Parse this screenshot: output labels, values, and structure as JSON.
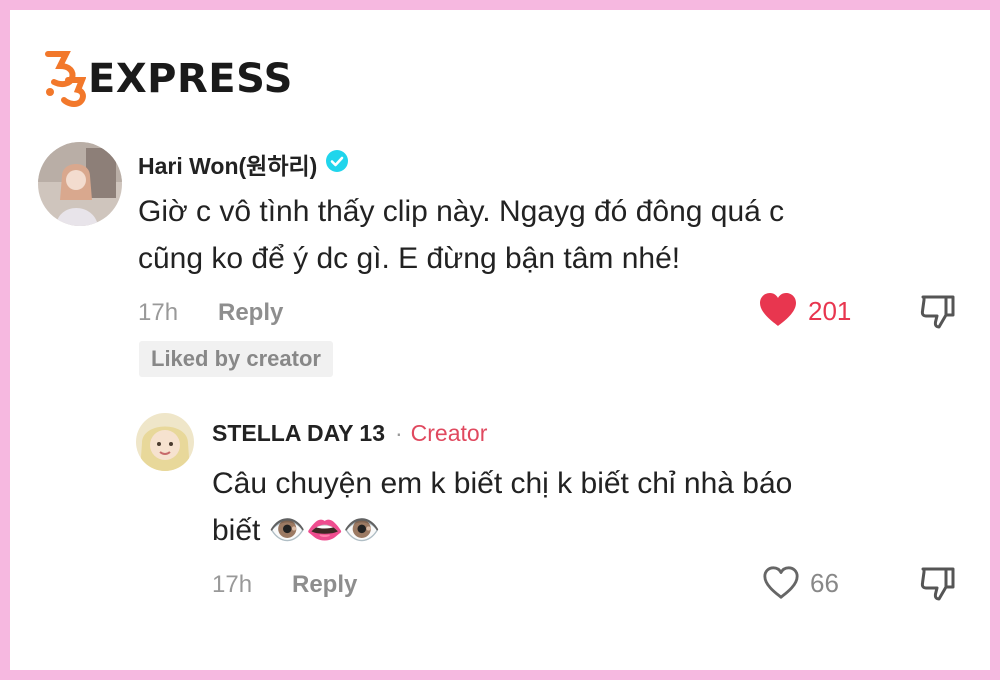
{
  "brand": {
    "logo_text": "EXPRESS",
    "logo_mark": "35"
  },
  "comments": [
    {
      "author": "Hari Won(원하리)",
      "verified": true,
      "text_line1": "Giờ c vô tình thấy clip này. Ngayg đó đông quá c",
      "text_line2": "cũng ko để ý dc gì. E đừng bận tâm nhé!",
      "time": "17h",
      "reply_label": "Reply",
      "likes": "201",
      "liked": true,
      "liked_by_creator": "Liked by creator",
      "like_color": "#e8364f"
    },
    {
      "author": "STELLA DAY 13",
      "separator": "·",
      "badge": "Creator",
      "text_line1": "Câu chuyện em k biết chị k biết chỉ nhà báo",
      "text_line2": "biết 👁️👄👁️",
      "time": "17h",
      "reply_label": "Reply",
      "likes": "66",
      "liked": false
    }
  ]
}
